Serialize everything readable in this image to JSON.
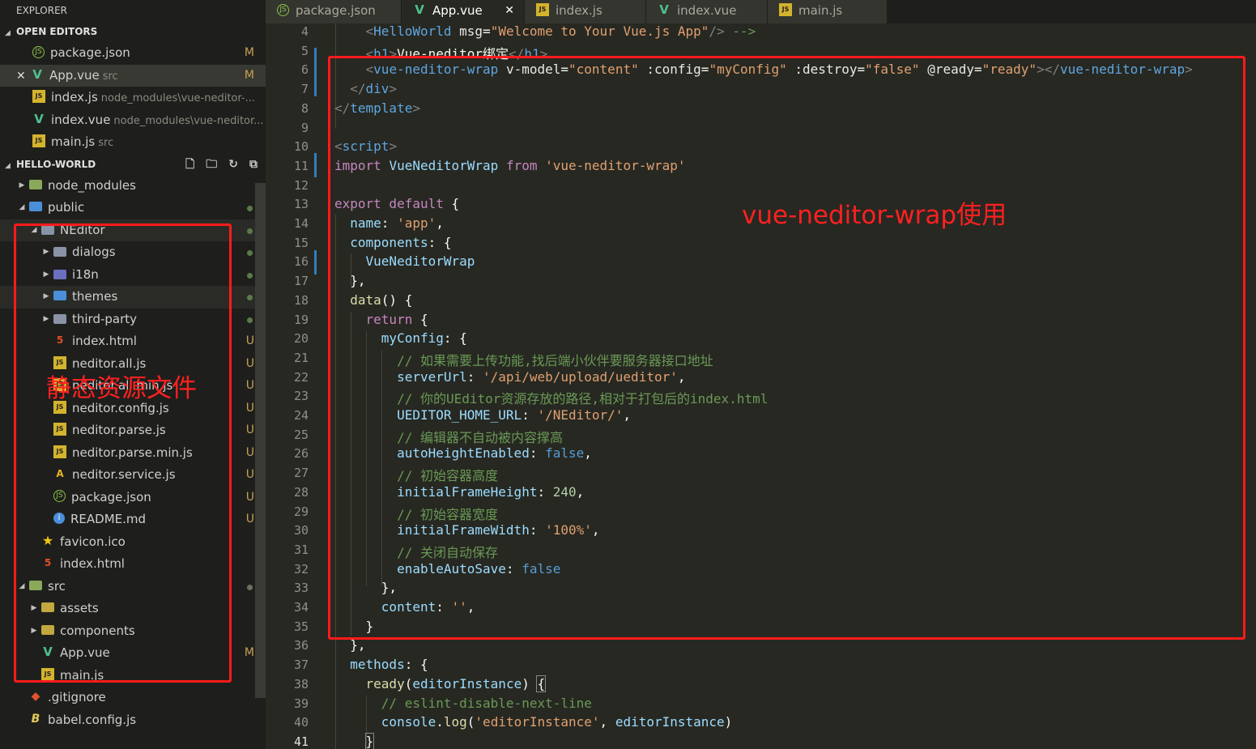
{
  "sidebar": {
    "title": "EXPLORER",
    "open_editors_header": "OPEN EDITORS",
    "open_editors": [
      {
        "icon": "json-icon",
        "name": "package.json",
        "desc": "",
        "status": "M"
      },
      {
        "icon": "vue-icon",
        "name": "App.vue",
        "desc": "src",
        "status": "M",
        "close": "✕"
      },
      {
        "icon": "js-icon",
        "name": "index.js",
        "desc": "node_modules\\vue-neditor-...",
        "status": ""
      },
      {
        "icon": "vue-icon",
        "name": "index.vue",
        "desc": "node_modules\\vue-neditor...",
        "status": ""
      },
      {
        "icon": "js-icon",
        "name": "main.js",
        "desc": "src",
        "status": ""
      }
    ],
    "project_header": "HELLO-WORLD",
    "tree": [
      {
        "name": "node_modules",
        "status": ""
      },
      {
        "name": "public",
        "status": "dot"
      },
      {
        "name": "NEditor",
        "status": "dot"
      },
      {
        "name": "dialogs",
        "status": "dot"
      },
      {
        "name": "i18n",
        "status": "dot"
      },
      {
        "name": "themes",
        "status": "dot"
      },
      {
        "name": "third-party",
        "status": "dot"
      },
      {
        "name": "index.html",
        "status": "U"
      },
      {
        "name": "neditor.all.js",
        "status": "U"
      },
      {
        "name": "neditor.all.min.js",
        "status": "U"
      },
      {
        "name": "neditor.config.js",
        "status": "U"
      },
      {
        "name": "neditor.parse.js",
        "status": "U"
      },
      {
        "name": "neditor.parse.min.js",
        "status": "U"
      },
      {
        "name": "neditor.service.js",
        "status": "U"
      },
      {
        "name": "package.json",
        "status": "U"
      },
      {
        "name": "README.md",
        "status": "U"
      },
      {
        "name": "favicon.ico",
        "status": ""
      },
      {
        "name": "index.html",
        "status": ""
      },
      {
        "name": "src",
        "status": "dot"
      },
      {
        "name": "assets",
        "status": ""
      },
      {
        "name": "components",
        "status": ""
      },
      {
        "name": "App.vue",
        "status": "M"
      },
      {
        "name": "main.js",
        "status": ""
      },
      {
        "name": ".gitignore",
        "status": ""
      },
      {
        "name": "babel.config.js",
        "status": ""
      }
    ]
  },
  "tabs": [
    {
      "name": "package.json"
    },
    {
      "name": "App.vue",
      "close": "✕"
    },
    {
      "name": "index.js"
    },
    {
      "name": "index.vue"
    },
    {
      "name": "main.js"
    }
  ],
  "editor": {
    "line_numbers": [
      "4",
      "5",
      "6",
      "7",
      "8",
      "9",
      "10",
      "11",
      "12",
      "13",
      "14",
      "15",
      "16",
      "17",
      "18",
      "19",
      "20",
      "21",
      "22",
      "23",
      "24",
      "25",
      "26",
      "27",
      "28",
      "29",
      "30",
      "31",
      "32",
      "33",
      "34",
      "35",
      "36",
      "37",
      "38",
      "39",
      "40",
      "41"
    ]
  },
  "annotations": {
    "code_label": "vue-neditor-wrap使用",
    "tree_label": "静态资源文件"
  },
  "colors": {
    "annotation": "#ff1a1a",
    "editor_bg": "#272822",
    "sidebar_bg": "#1e1f1c"
  }
}
